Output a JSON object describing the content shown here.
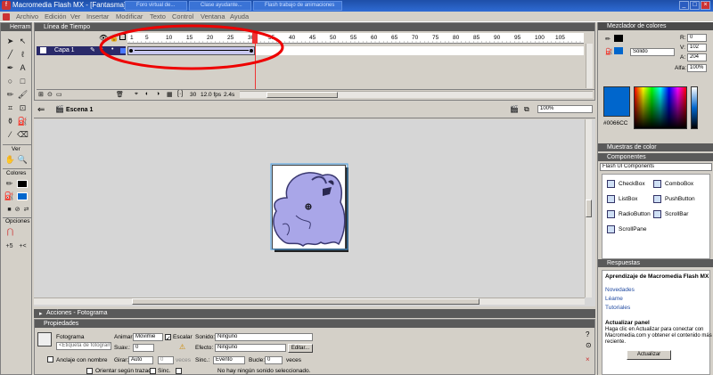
{
  "app": {
    "title": "Macromedia Flash MX - [Fantasma]",
    "taskbar_tabs": [
      "Foro virtual de...",
      "Clase ayudante...",
      "Flash trabajo de animaciones"
    ],
    "window_controls": [
      "_",
      "□",
      "×"
    ]
  },
  "menu": [
    "Archivo",
    "Edición",
    "Ver",
    "Insertar",
    "Modificar",
    "Texto",
    "Control",
    "Ventana",
    "Ayuda"
  ],
  "tools": {
    "title": "Herram",
    "section_view": "Ver",
    "section_colors": "Colores",
    "section_options": "Opciones"
  },
  "timeline": {
    "title": "Línea de Tiempo",
    "layer_name": "Capa 1",
    "frame_numbers": [
      "1",
      "5",
      "10",
      "15",
      "20",
      "25",
      "30",
      "35",
      "40",
      "45",
      "50",
      "55",
      "60",
      "65",
      "70",
      "75",
      "80",
      "85",
      "90",
      "95",
      "100",
      "105"
    ],
    "current_frame": "30",
    "fps": "12.0 fps",
    "time": "2.4s"
  },
  "stage": {
    "scene": "Escena 1",
    "zoom": "100%"
  },
  "color_mixer": {
    "title": "Mezclador de colores",
    "r_label": "R:",
    "r_value": "0",
    "g_label": "V:",
    "g_value": "102",
    "b_label": "A:",
    "b_value": "204",
    "alpha_label": "Alfa:",
    "alpha_value": "100%",
    "fill_type": "Sólido",
    "hex": "#0066CC",
    "swatch_color": "#0066CC"
  },
  "swatches": {
    "title": "Muestras de color"
  },
  "components": {
    "title": "Componentes",
    "set": "Flash UI Components",
    "items": [
      "CheckBox",
      "ComboBox",
      "ListBox",
      "PushButton",
      "RadioButton",
      "ScrollBar",
      "ScrollPane"
    ]
  },
  "answers": {
    "title": "Respuestas",
    "heading": "Aprendizaje de Macromedia Flash MX",
    "links": [
      "Novedades",
      "Léame",
      "Tutoriales"
    ],
    "update_heading": "Actualizar panel",
    "update_text_1": "Haga clic en Actualizar para conectar con",
    "update_text_2": "Macromedia.com y obtener el contenido más",
    "update_text_3": "reciente.",
    "update_button": "Actualizar"
  },
  "actions": {
    "title": "Acciones - Fotograma"
  },
  "properties": {
    "title": "Propiedades",
    "frame_label": "Fotograma",
    "frame_placeholder": "<Etiqueta de fotograma>",
    "animate_label": "Animar:",
    "animate_value": "Movimie",
    "scale_label": "Escalar",
    "sound_label": "Sonido:",
    "sound_value": "Ninguno",
    "ease_label": "Suav.:",
    "ease_value": "0",
    "effect_label": "Efecto:",
    "effect_value": "Ninguno",
    "edit_button": "Editar...",
    "anchor_label": "Anclaje con nombre",
    "rotate_label": "Girar:",
    "rotate_value": "Auto",
    "times_value": "0",
    "times_label": "veces",
    "sync_label": "Sinc.:",
    "sync_value": "Evento",
    "loop_label": "Bucle:",
    "loop_value": "0",
    "loop_unit": "veces",
    "orient_label": "Orientar según trazado",
    "sync_check": "Sinc.",
    "snap_check": "Ajustar",
    "no_sound": "No hay ningún sonido seleccionado."
  }
}
